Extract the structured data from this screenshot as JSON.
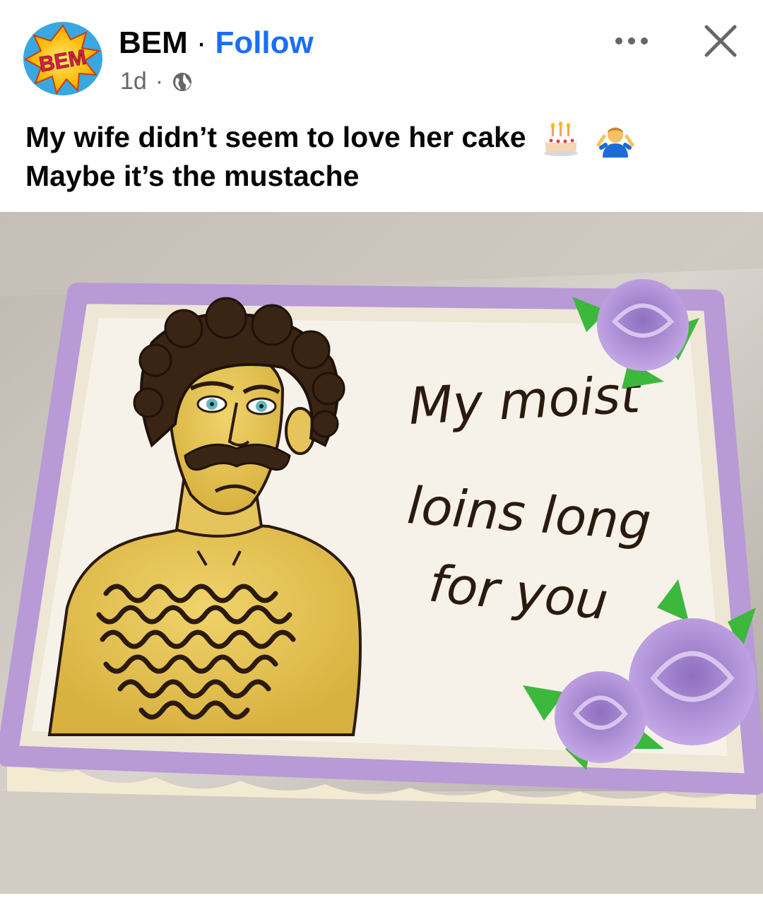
{
  "post": {
    "author": "BEM",
    "separator": "·",
    "follow_label": "Follow",
    "timestamp": "1d",
    "meta_separator": "·",
    "audience_icon": "globe-icon",
    "avatar_logo_text": "BEM",
    "caption_line1": "My wife didn’t seem to love her cake",
    "caption_line2": "Maybe it’s the mustache",
    "caption_emojis": [
      "birthday-cake-emoji",
      "man-shrugging-emoji"
    ]
  },
  "actions": {
    "more_icon": "more-options-icon",
    "close_icon": "close-icon"
  },
  "photo": {
    "cake_text_line1": "My moist",
    "cake_text_line2": "loins long",
    "cake_text_line3": "for you"
  },
  "colors": {
    "follow_blue": "#1b6ef3",
    "text": "#050505",
    "meta_gray": "#65676b",
    "frosting_purple": "#b79ad6",
    "cake_white": "#f6f2ea"
  }
}
